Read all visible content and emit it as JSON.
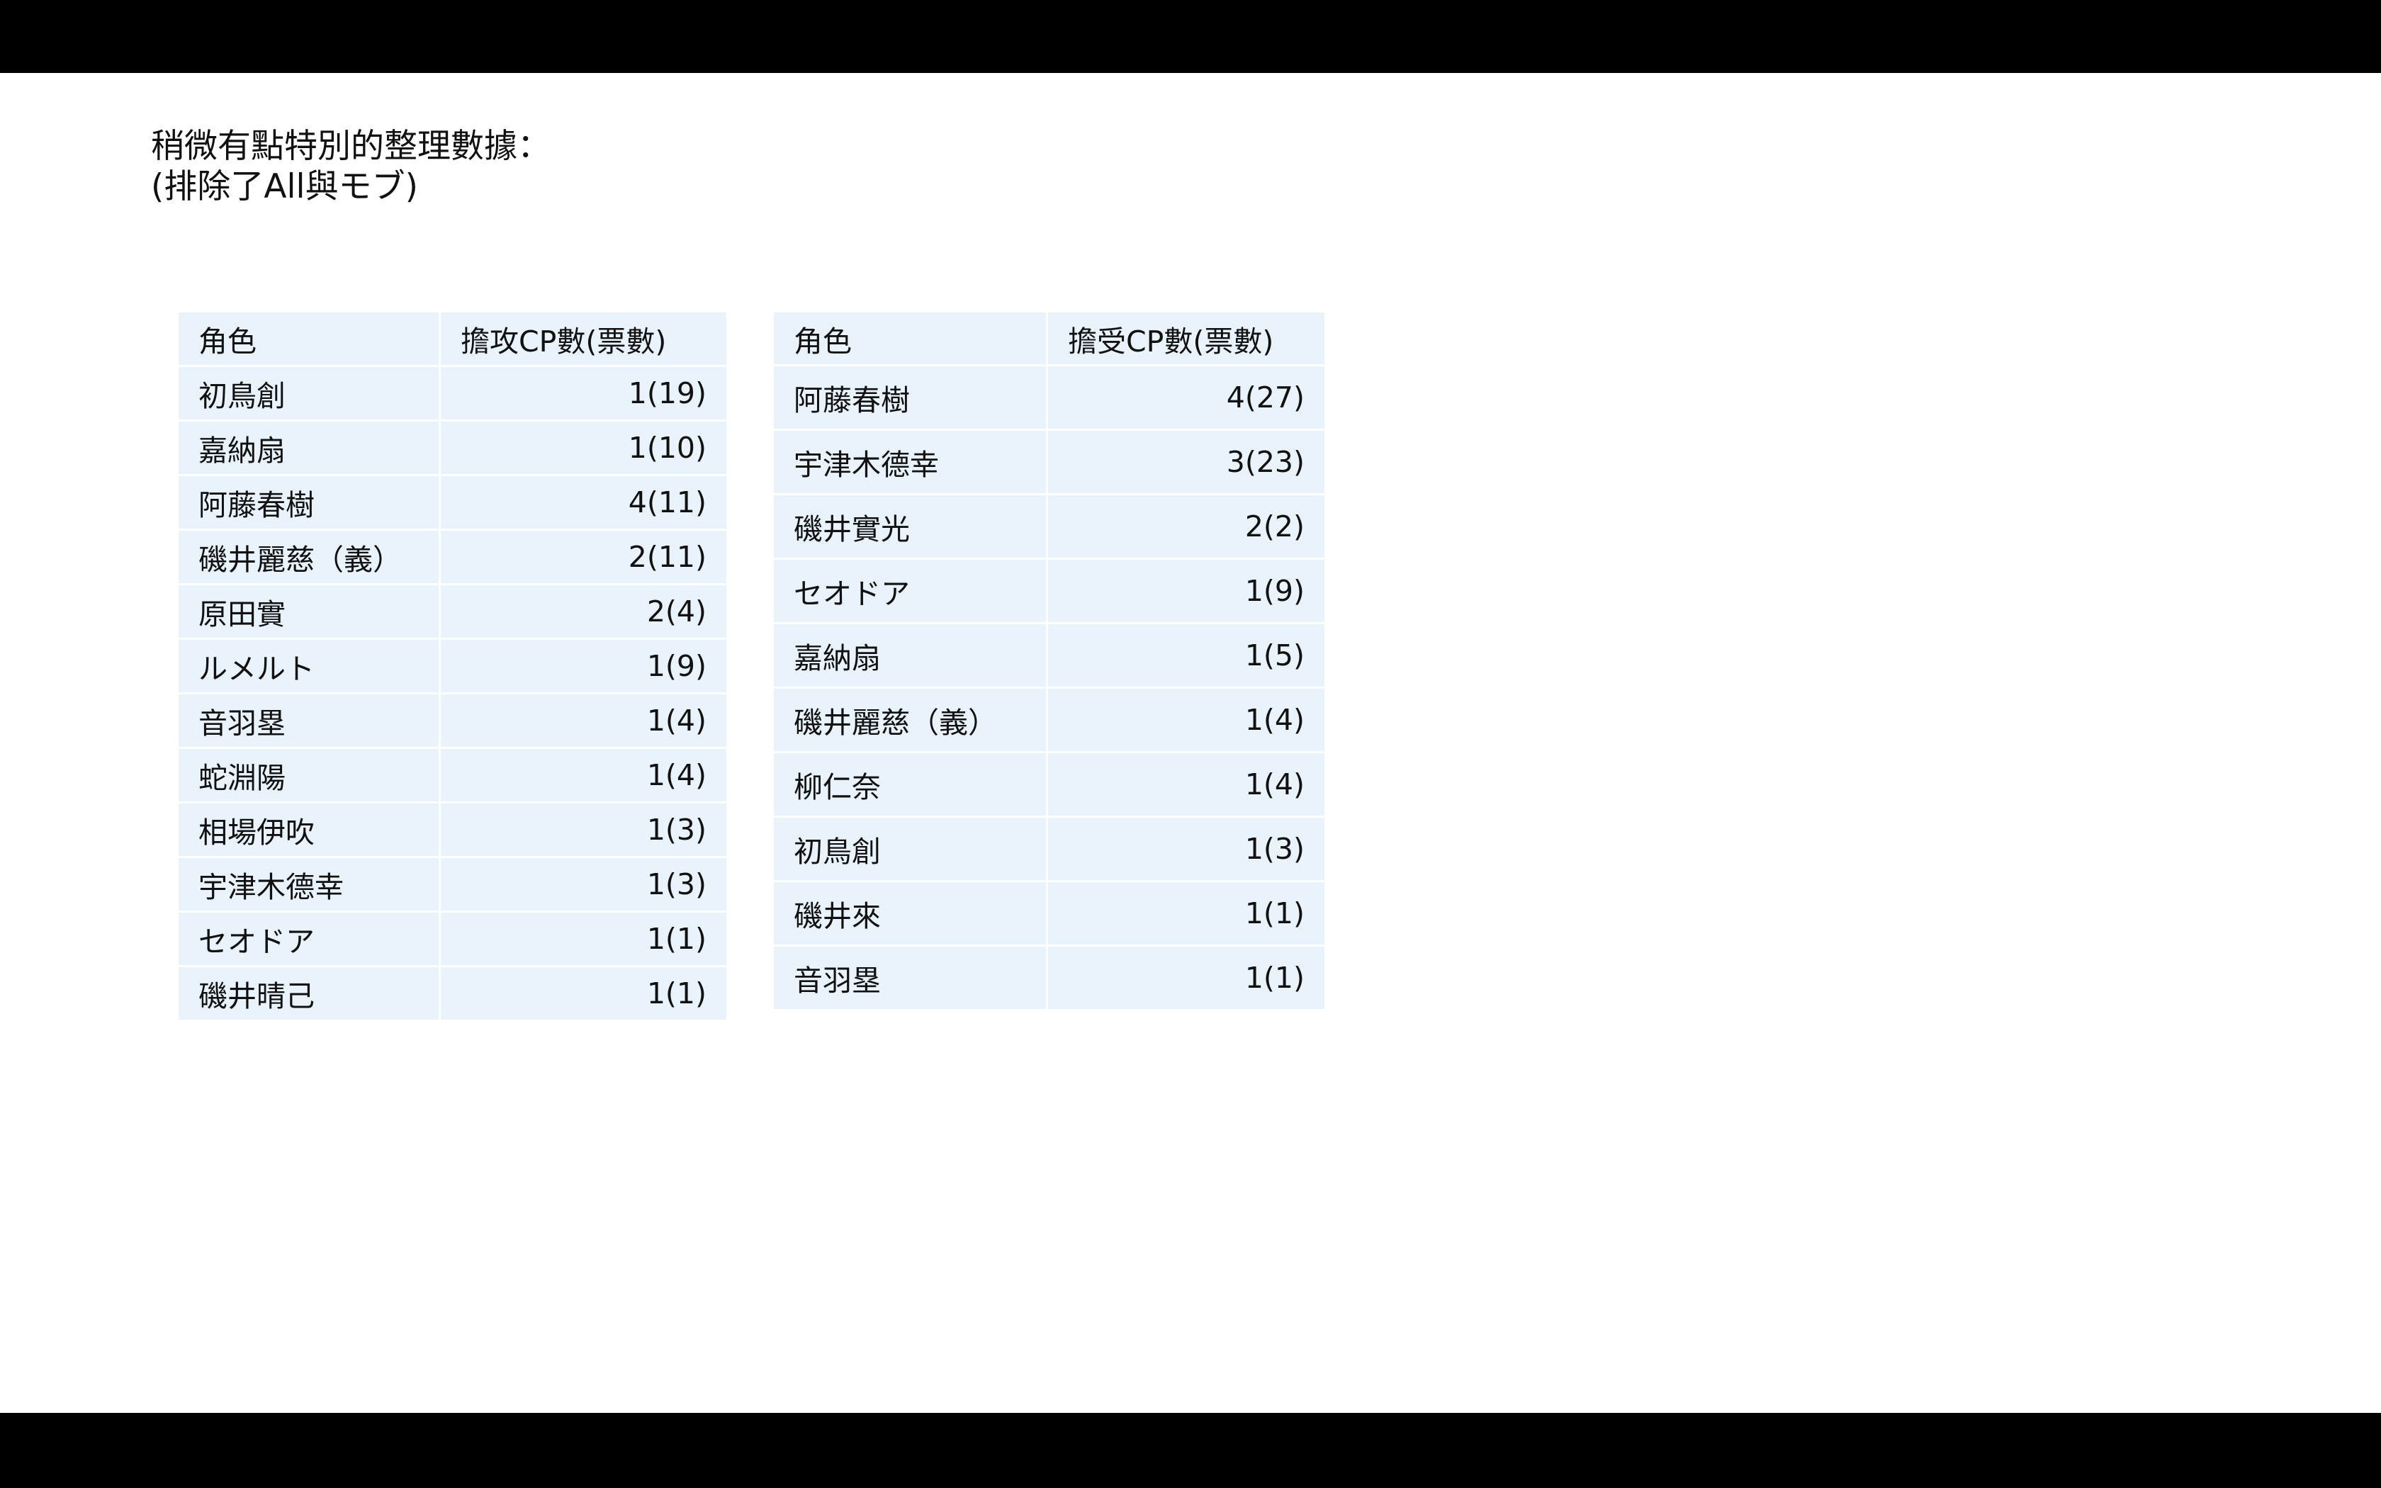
{
  "heading": {
    "line1": "稍微有點特別的整理數據：",
    "line2": "(排除了All與モブ)"
  },
  "attack_table": {
    "header": {
      "role": "角色",
      "value": "擔攻CP數(票數)"
    },
    "rows": [
      {
        "role": "初鳥創",
        "value": "1(19)"
      },
      {
        "role": "嘉納扇",
        "value": "1(10)"
      },
      {
        "role": "阿藤春樹",
        "value": "4(11)"
      },
      {
        "role": "磯井麗慈（義）",
        "value": "2(11)"
      },
      {
        "role": "原田實",
        "value": "2(4)"
      },
      {
        "role": "ルメルト",
        "value": "1(9)"
      },
      {
        "role": "音羽塁",
        "value": "1(4)"
      },
      {
        "role": "蛇淵陽",
        "value": "1(4)"
      },
      {
        "role": "相場伊吹",
        "value": "1(3)"
      },
      {
        "role": "宇津木德幸",
        "value": "1(3)"
      },
      {
        "role": "セオドア",
        "value": "1(1)"
      },
      {
        "role": "磯井晴己",
        "value": "1(1)"
      }
    ]
  },
  "receive_table": {
    "header": {
      "role": "角色",
      "value": "擔受CP數(票數)"
    },
    "rows": [
      {
        "role": "阿藤春樹",
        "value": "4(27)"
      },
      {
        "role": "宇津木德幸",
        "value": "3(23)"
      },
      {
        "role": "磯井實光",
        "value": "2(2)"
      },
      {
        "role": "セオドア",
        "value": "1(9)"
      },
      {
        "role": "嘉納扇",
        "value": "1(5)"
      },
      {
        "role": "磯井麗慈（義）",
        "value": "1(4)"
      },
      {
        "role": "柳仁奈",
        "value": "1(4)"
      },
      {
        "role": "初鳥創",
        "value": "1(3)"
      },
      {
        "role": "磯井來",
        "value": "1(1)"
      },
      {
        "role": "音羽塁",
        "value": "1(1)"
      }
    ]
  },
  "colors": {
    "cell_background": "#e8f3fb",
    "letterbox": "#000000",
    "slide_background": "#ffffff"
  }
}
